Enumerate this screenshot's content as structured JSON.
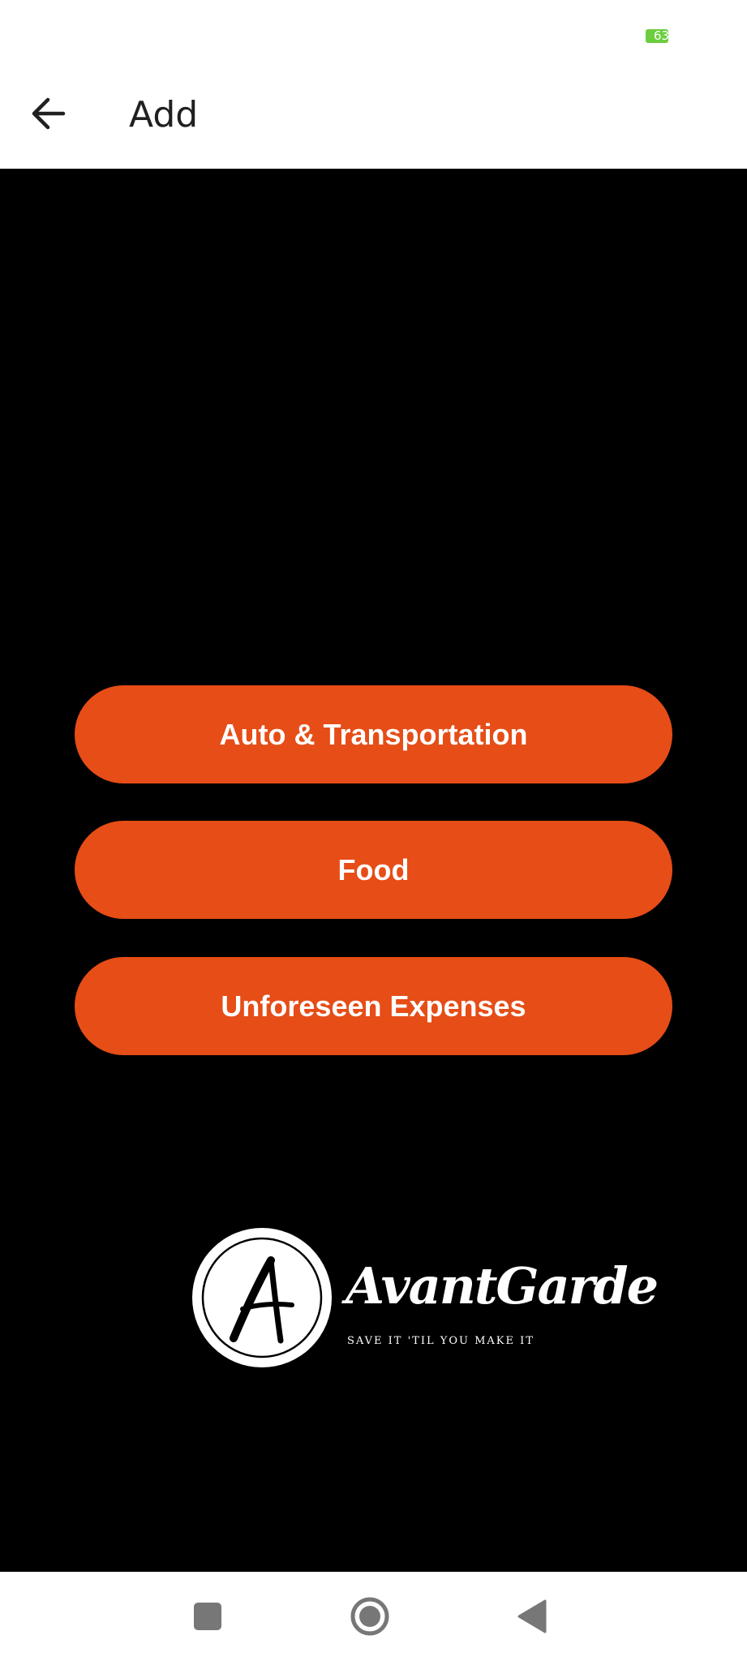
{
  "status_bar": {
    "battery_level": "63",
    "battery_color": "#6ccd3f"
  },
  "app_bar": {
    "back_icon": "arrow-left-icon",
    "title": "Add"
  },
  "categories": [
    {
      "label": "Auto & Transportation"
    },
    {
      "label": "Food"
    },
    {
      "label": "Unforeseen Expenses"
    }
  ],
  "logo": {
    "name": "AvantGarde",
    "tagline": "SAVE IT 'TIL YOU MAKE IT",
    "badge_letter": "A"
  },
  "nav_bar": {
    "icons": [
      "recents-square-icon",
      "home-circle-icon",
      "back-triangle-icon"
    ]
  },
  "colors": {
    "accent": "#e64d17",
    "background": "#000000",
    "surface": "#ffffff"
  }
}
